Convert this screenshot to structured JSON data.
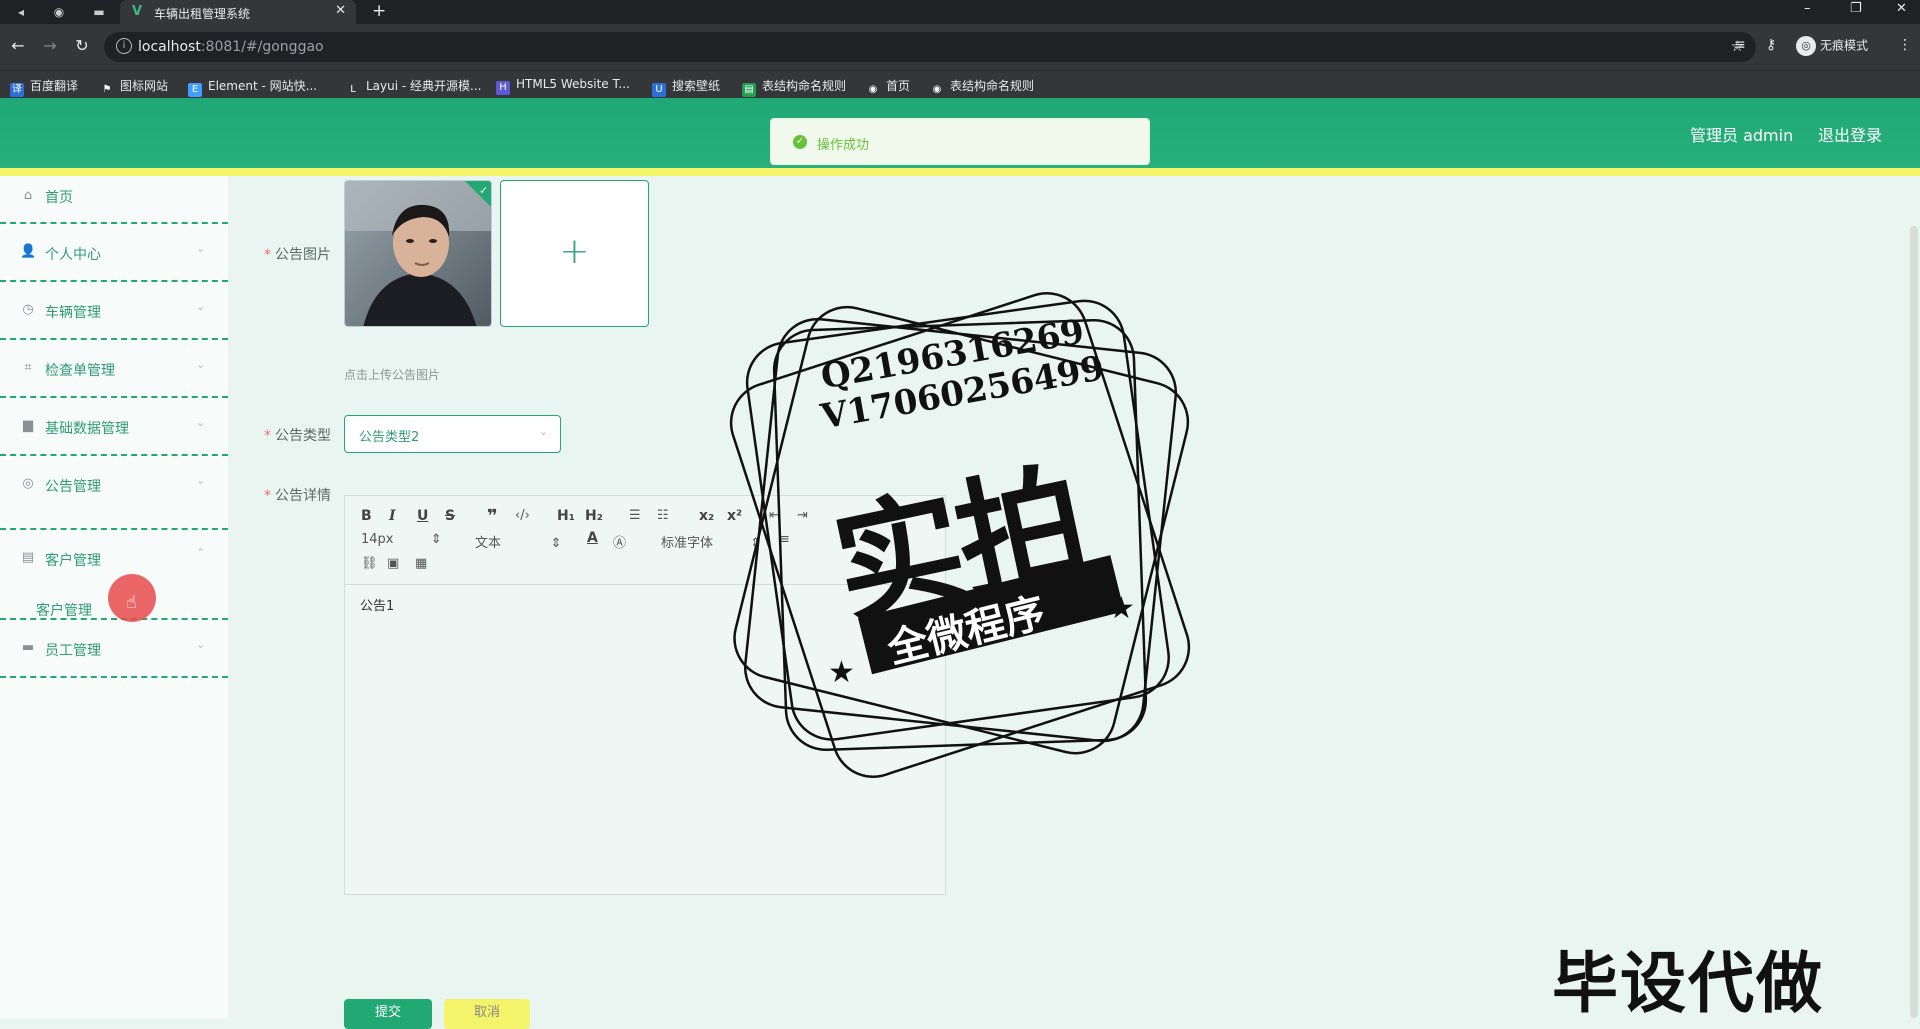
{
  "browser": {
    "tab_title": "车辆出租管理系统",
    "url_host": "localhost",
    "url_path": ":8081/#/gonggao",
    "incognito_label": "无痕模式",
    "bookmarks": [
      "百度翻译",
      "图标网站",
      "Element - 网站快...",
      "Layui - 经典开源模...",
      "HTML5 Website T...",
      "搜索壁纸",
      "表结构命名规则",
      "首页",
      "表结构命名规则"
    ]
  },
  "header": {
    "user_label": "管理员 admin",
    "logout_label": "退出登录"
  },
  "toast": {
    "message": "操作成功"
  },
  "sidebar": {
    "items": [
      {
        "label": "首页",
        "icon": "home-icon"
      },
      {
        "label": "个人中心",
        "icon": "user-icon"
      },
      {
        "label": "车辆管理",
        "icon": "compass-icon"
      },
      {
        "label": "检查单管理",
        "icon": "crop-icon"
      },
      {
        "label": "基础数据管理",
        "icon": "briefcase-icon"
      },
      {
        "label": "公告管理",
        "icon": "aim-icon"
      },
      {
        "label": "客户管理",
        "icon": "tickets-icon"
      },
      {
        "label": "员工管理",
        "icon": "monitor-icon"
      }
    ],
    "submenu_label": "客户管理"
  },
  "form": {
    "image_label": "公告图片",
    "upload_hint": "点击上传公告图片",
    "type_label": "公告类型",
    "type_value": "公告类型2",
    "detail_label": "公告详情",
    "editor": {
      "font_size": "14px",
      "text_style": "文本",
      "font_family": "标准字体",
      "content": "公告1"
    },
    "submit_label": "提交",
    "cancel_label": "取消"
  },
  "watermark": {
    "line1": "Q2196316269",
    "line2": "V17060256499",
    "big_text": "实拍",
    "ribbon_text": "全微程序",
    "bottom_text": "毕设代做"
  },
  "colors": {
    "primary": "#22a872",
    "accent_yellow": "#f4f46a",
    "success": "#67c23a"
  }
}
